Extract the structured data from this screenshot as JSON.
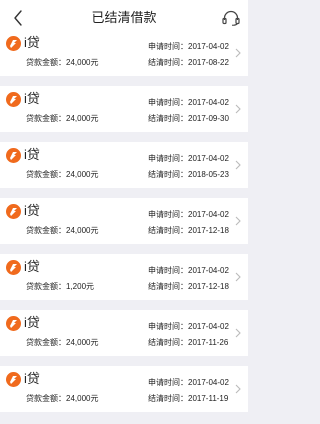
{
  "header": {
    "title": "已结清借款",
    "back_icon": "back-arrow-icon",
    "service_icon": "headset-icon"
  },
  "colors": {
    "brand": "#f06a1d",
    "background": "#efeff4"
  },
  "loans": [
    {
      "brand": "i贷",
      "amount_label": "贷款金额：",
      "amount": "24,000元",
      "apply_label": "申请时间：",
      "apply_date": "2017-04-02",
      "settle_label": "结清时间：",
      "settle_date": "2017-08-22"
    },
    {
      "brand": "i贷",
      "amount_label": "贷款金额：",
      "amount": "24,000元",
      "apply_label": "申请时间：",
      "apply_date": "2017-04-02",
      "settle_label": "结清时间：",
      "settle_date": "2017-09-30"
    },
    {
      "brand": "i贷",
      "amount_label": "贷款金额：",
      "amount": "24,000元",
      "apply_label": "申请时间：",
      "apply_date": "2017-04-02",
      "settle_label": "结清时间：",
      "settle_date": "2018-05-23"
    },
    {
      "brand": "i贷",
      "amount_label": "贷款金额：",
      "amount": "24,000元",
      "apply_label": "申请时间：",
      "apply_date": "2017-04-02",
      "settle_label": "结清时间：",
      "settle_date": "2017-12-18"
    },
    {
      "brand": "i贷",
      "amount_label": "贷款金额：",
      "amount": "1,200元",
      "apply_label": "申请时间：",
      "apply_date": "2017-04-02",
      "settle_label": "结清时间：",
      "settle_date": "2017-12-18"
    },
    {
      "brand": "i贷",
      "amount_label": "贷款金额：",
      "amount": "24,000元",
      "apply_label": "申请时间：",
      "apply_date": "2017-04-02",
      "settle_label": "结清时间：",
      "settle_date": "2017-11-26"
    },
    {
      "brand": "i贷",
      "amount_label": "贷款金额：",
      "amount": "24,000元",
      "apply_label": "申请时间：",
      "apply_date": "2017-04-02",
      "settle_label": "结清时间：",
      "settle_date": "2017-11-19"
    }
  ]
}
